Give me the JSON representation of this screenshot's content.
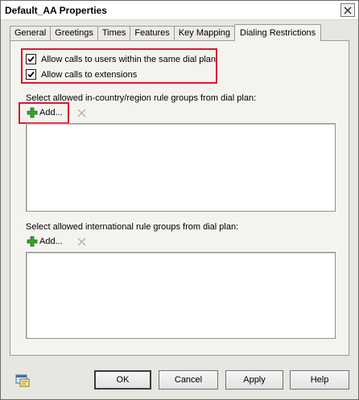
{
  "window": {
    "title": "Default_AA Properties"
  },
  "tabs": [
    {
      "label": "General"
    },
    {
      "label": "Greetings"
    },
    {
      "label": "Times"
    },
    {
      "label": "Features"
    },
    {
      "label": "Key Mapping"
    },
    {
      "label": "Dialing Restrictions",
      "active": true
    }
  ],
  "options": {
    "allow_same_dial_plan": {
      "label": "Allow calls to users within the same dial plan",
      "checked": true
    },
    "allow_extensions": {
      "label": "Allow calls to extensions",
      "checked": true
    }
  },
  "in_country": {
    "label": "Select allowed in-country/region rule groups from dial plan:",
    "add_label": "Add..."
  },
  "international": {
    "label": "Select allowed international rule groups from dial plan:",
    "add_label": "Add..."
  },
  "buttons": {
    "ok": "OK",
    "cancel": "Cancel",
    "apply": "Apply",
    "help": "Help"
  },
  "icons": {
    "add": "plus-icon",
    "remove": "x-icon",
    "close": "close-icon",
    "properties": "properties-icon"
  },
  "colors": {
    "highlight": "#d9192c",
    "add_green": "#3aa02f"
  }
}
